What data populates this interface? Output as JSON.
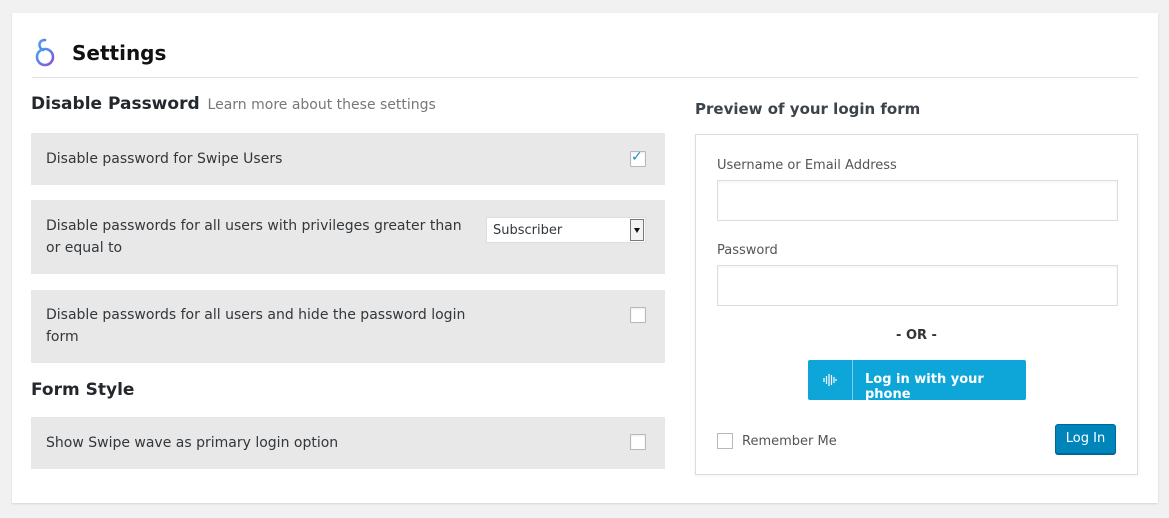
{
  "header": {
    "title": "Settings"
  },
  "disable_password": {
    "heading": "Disable Password",
    "learn_more": "Learn more about these settings",
    "rows": [
      {
        "label": "Disable password for Swipe Users",
        "checked": true
      },
      {
        "label": "Disable passwords for all users with privileges greater than or equal to",
        "select_value": "Subscriber"
      },
      {
        "label": "Disable passwords for all users and hide the password login form",
        "checked": false
      }
    ]
  },
  "form_style": {
    "heading": "Form Style",
    "rows": [
      {
        "label": "Show Swipe wave as primary login option",
        "checked": false
      }
    ]
  },
  "preview": {
    "title": "Preview of your login form",
    "username_label": "Username or Email Address",
    "username_value": "",
    "password_label": "Password",
    "password_value": "",
    "or_text": "- OR -",
    "phone_button": "Log in with your phone",
    "remember_me": "Remember Me",
    "login_button": "Log In"
  },
  "colors": {
    "accent": "#0085ba",
    "phone_button": "#0ea5d8",
    "row_bg": "#e8e8e8"
  }
}
